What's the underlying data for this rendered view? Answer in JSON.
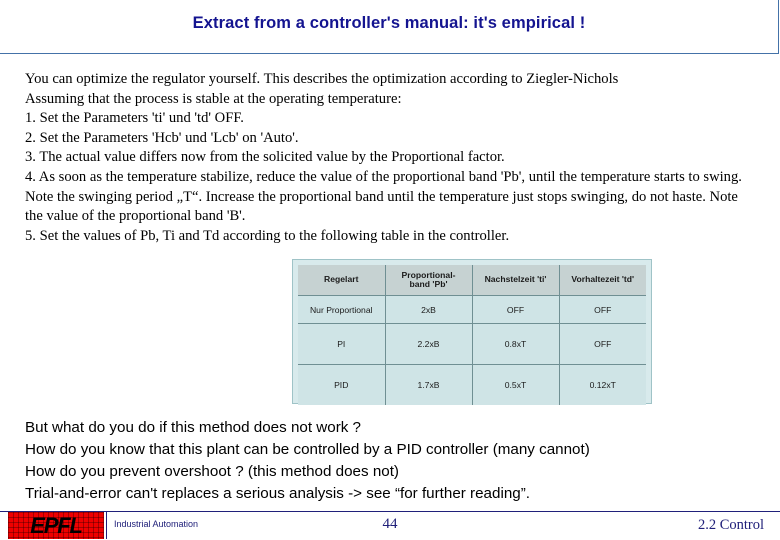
{
  "slide": {
    "title": "Extract from a controller's manual: it's empirical !",
    "title_color": "#141490"
  },
  "body": {
    "lines": [
      "You can optimize the regulator yourself. This describes the optimization according to Ziegler-Nichols",
      "Assuming that the process is stable at the operating temperature:",
      "1. Set the Parameters 'ti' und 'td' OFF.",
      "2. Set the Parameters 'Hcb' und 'Lcb' on 'Auto'.",
      "3. The actual value differs now from the solicited value by the Proportional factor.",
      "4. As soon as the temperature stabilize, reduce the value of the proportional band  'Pb', until the temperature starts to swing. Note the swinging period „T“. Increase the proportional band until the temperature just stops swinging, do not haste. Note the value of the proportional band 'B'.",
      "5. Set the values of Pb, Ti and Td according to the following table in the controller."
    ]
  },
  "table": {
    "headers": [
      "Regelart",
      "Proportional-band 'Pb'",
      "Nachstelzeit 'ti'",
      "Vorhaltezeit 'td'"
    ],
    "header_lines": [
      [
        "Regelart"
      ],
      [
        "Proportional-",
        "band 'Pb'"
      ],
      [
        "Nachstelzeit 'ti'"
      ],
      [
        "Vorhaltezeit 'td'"
      ]
    ],
    "rows": [
      [
        "Nur Proportional",
        "2xB",
        "OFF",
        "OFF"
      ],
      [
        "PI",
        "2.2xB",
        "0.8xT",
        "OFF"
      ],
      [
        "PID",
        "1.7xB",
        "0.5xT",
        "0.12xT"
      ]
    ],
    "header_bg": "#c6d2d2",
    "cell_bg": "#cfe4e6",
    "frame_bg": "#d8eaec"
  },
  "questions": {
    "lines": [
      "But what do you do if this method does not work ?",
      "How do you know that this plant can be controlled by a PID controller (many cannot)",
      "How do you prevent overshoot ? (this method does not)",
      "Trial-and-error can't replaces a serious analysis -> see “for further reading”."
    ]
  },
  "footer": {
    "logo_text": "EPFL",
    "course": "Industrial Automation",
    "page_number": "44",
    "section": "2.2 Control",
    "color": "#20207a",
    "logo_color": "#ee0000"
  }
}
